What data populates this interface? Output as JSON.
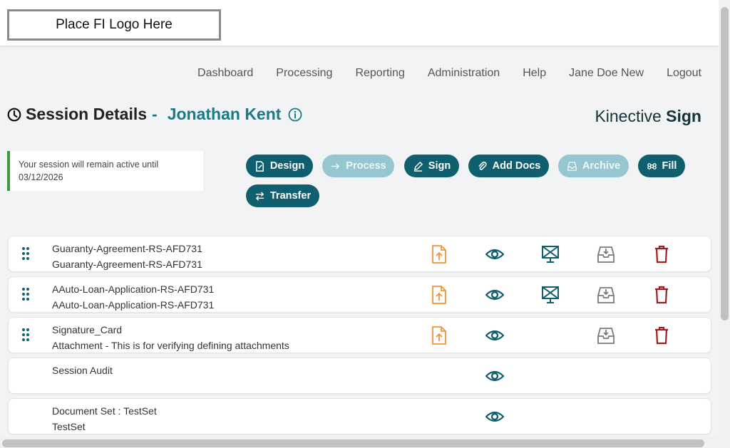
{
  "header": {
    "logo_text": "Place FI Logo Here"
  },
  "nav": {
    "items": [
      "Dashboard",
      "Processing",
      "Reporting",
      "Administration",
      "Help",
      "Jane Doe New",
      "Logout"
    ]
  },
  "page": {
    "title": "Session Details",
    "separator": "-",
    "customer_name": "Jonathan Kent",
    "brand_prefix": "Kinective ",
    "brand_bold": "Sign"
  },
  "session_note": {
    "line1": "Your session will remain active until",
    "line2": "03/12/2026"
  },
  "actions": {
    "design": "Design",
    "process": "Process",
    "sign": "Sign",
    "add_docs": "Add Docs",
    "archive": "Archive",
    "fill": "Fill",
    "transfer": "Transfer"
  },
  "documents": [
    {
      "line1": "Guaranty-Agreement-RS-AFD731",
      "line2": "Guaranty-Agreement-RS-AFD731"
    },
    {
      "line1": "AAuto-Loan-Application-RS-AFD731",
      "line2": "AAuto-Loan-Application-RS-AFD731"
    },
    {
      "line1": "Signature_Card",
      "line2": "Attachment - This is for verifying defining attachments"
    },
    {
      "line1": "Session Audit",
      "line2": ""
    },
    {
      "line1": "Document Set : TestSet",
      "line2": "TestSet"
    }
  ],
  "colors": {
    "accent": "#105f6f",
    "accent_disabled": "#96c6cf",
    "teal_text": "#197a8a",
    "upload_orange": "#f0953a",
    "delete_red": "#a11d1d",
    "archive_gray": "#7a7a7a",
    "session_green": "#3d9a3d"
  }
}
